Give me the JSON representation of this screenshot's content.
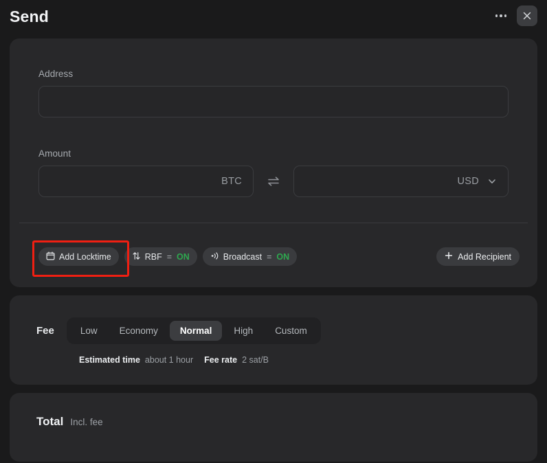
{
  "header": {
    "title": "Send",
    "menu_icon": "ellipsis-icon",
    "close_icon": "close-icon"
  },
  "recipient": {
    "address_label": "Address",
    "address_value": "",
    "address_placeholder": "",
    "amount_label": "Amount",
    "amount_btc_value": "",
    "amount_btc_unit": "BTC",
    "swap_icon": "swap-horizontal-icon",
    "amount_fiat_value": "",
    "amount_fiat_unit": "USD",
    "fiat_chevron_icon": "chevron-down-icon",
    "toolbar": {
      "locktime_label": "Add Locktime",
      "locktime_icon": "calendar-icon",
      "rbf_label": "RBF",
      "rbf_icon": "swap-vertical-icon",
      "rbf_equals": "=",
      "rbf_state": "ON",
      "broadcast_label": "Broadcast",
      "broadcast_icon": "broadcast-icon",
      "broadcast_equals": "=",
      "broadcast_state": "ON",
      "add_recipient_label": "Add Recipient",
      "add_recipient_icon": "plus-icon"
    }
  },
  "fee": {
    "label": "Fee",
    "options": [
      "Low",
      "Economy",
      "Normal",
      "High",
      "Custom"
    ],
    "selected": "Normal",
    "estimated_time_key": "Estimated time",
    "estimated_time_value": "about 1 hour",
    "fee_rate_key": "Fee rate",
    "fee_rate_value": "2 sat/B"
  },
  "total": {
    "label": "Total",
    "sublabel": "Incl. fee"
  },
  "colors": {
    "page_background": "#1a1a1b",
    "card_background": "#28282a",
    "accent_on": "#2ea84f",
    "highlight_border": "#f01f12",
    "pill_background": "#3a3b3e"
  }
}
